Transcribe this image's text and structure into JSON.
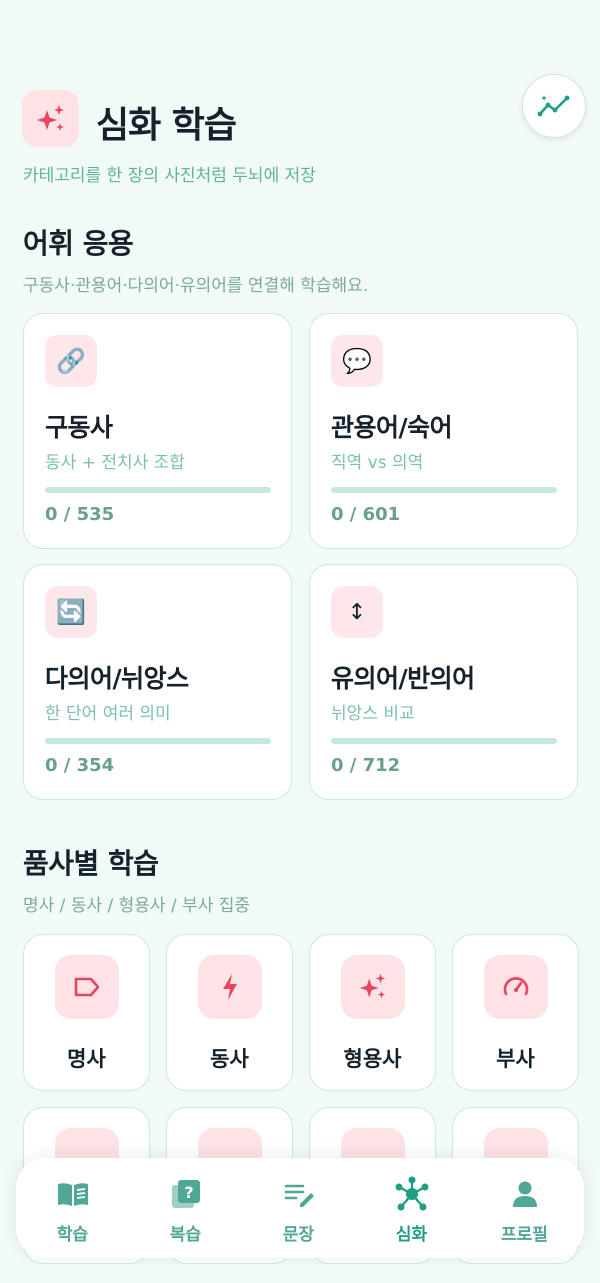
{
  "header": {
    "title": "심화 학습",
    "subtitle": "카테고리를 한 장의 사진처럼 두뇌에 저장",
    "icon": "sparkles-icon",
    "action_icon": "trend-chart-icon"
  },
  "vocab_section": {
    "title": "어휘 응용",
    "description": "구동사·관용어·다의어·유의어를 연결해 학습해요.",
    "cards": [
      {
        "icon": "link-icon",
        "glyph": "🔗",
        "title": "구동사",
        "desc": "동사 + 전치사 조합",
        "count": "0 / 535",
        "progress": 0
      },
      {
        "icon": "speech-bubble-icon",
        "glyph": "💬",
        "title": "관용어/숙어",
        "desc": "직역 vs 의역",
        "count": "0 / 601",
        "progress": 0
      },
      {
        "icon": "refresh-icon",
        "glyph": "🔄",
        "title": "다의어/뉘앙스",
        "desc": "한 단어 여러 의미",
        "count": "0 / 354",
        "progress": 0
      },
      {
        "icon": "up-down-arrow-icon",
        "glyph": "↕",
        "title": "유의어/반의어",
        "desc": "뉘앙스 비교",
        "count": "0 / 712",
        "progress": 0
      }
    ]
  },
  "pos_section": {
    "title": "품사별 학습",
    "description": "명사 / 동사 / 형용사 / 부사 집중",
    "cards": [
      {
        "icon": "tag-icon",
        "label": "명사"
      },
      {
        "icon": "bolt-icon",
        "label": "동사"
      },
      {
        "icon": "sparkles-icon",
        "label": "형용사"
      },
      {
        "icon": "gauge-icon",
        "label": "부사"
      }
    ]
  },
  "tabbar": {
    "tabs": [
      {
        "icon": "book-icon",
        "label": "학습",
        "active": false
      },
      {
        "icon": "question-card-icon",
        "label": "복습",
        "active": false
      },
      {
        "icon": "edit-lines-icon",
        "label": "문장",
        "active": false
      },
      {
        "icon": "network-icon",
        "label": "심화",
        "active": true
      },
      {
        "icon": "person-icon",
        "label": "프로필",
        "active": false
      }
    ]
  },
  "colors": {
    "background": "#f2faf7",
    "accent_teal": "#1f9e86",
    "accent_pink": "#e8435f",
    "icon_bg_pink": "#fde3e6",
    "card_border": "#c9ebe2"
  }
}
